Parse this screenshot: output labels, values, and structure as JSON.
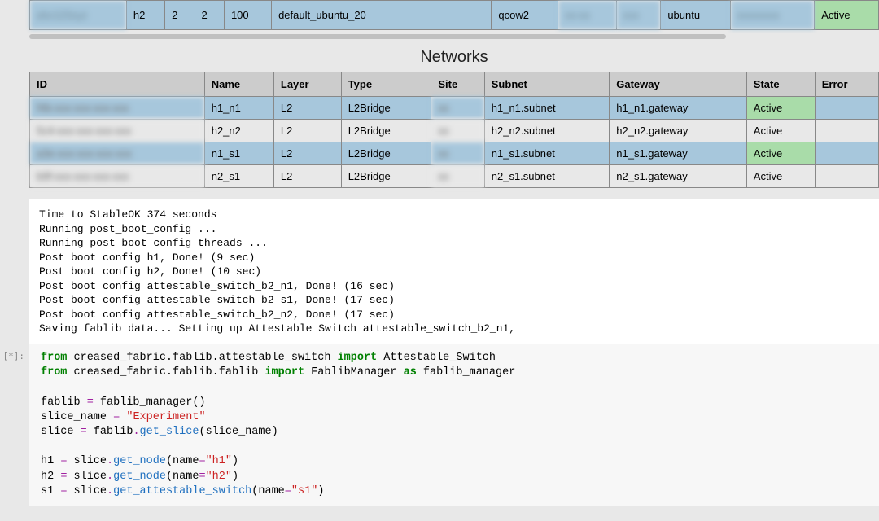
{
  "nodes_row": {
    "c0_blur": "abc123xyz",
    "name": "h2",
    "cpu": "2",
    "ram": "2",
    "disk": "100",
    "image": "default_ubuntu_20",
    "format": "qcow2",
    "c7_blur": "xx-xx",
    "c8_blur": "xxx",
    "user": "ubuntu",
    "c10_blur": "xxxxxxxx",
    "state": "Active"
  },
  "networks_title": "Networks",
  "net_headers": [
    "ID",
    "Name",
    "Layer",
    "Type",
    "Site",
    "Subnet",
    "Gateway",
    "State",
    "Error"
  ],
  "net_rows": [
    {
      "id_blur": "f4b-xxx-xxx-xxx-xxx",
      "name": "h1_n1",
      "layer": "L2",
      "type": "L2Bridge",
      "site_blur": "xx",
      "subnet": "h1_n1.subnet",
      "gateway": "h1_n1.gateway",
      "state": "Active",
      "error": "",
      "alt": false
    },
    {
      "id_blur": "5c4-xxx-xxx-xxx-xxx",
      "name": "h2_n2",
      "layer": "L2",
      "type": "L2Bridge",
      "site_blur": "xx",
      "subnet": "h2_n2.subnet",
      "gateway": "h2_n2.gateway",
      "state": "Active",
      "error": "",
      "alt": true
    },
    {
      "id_blur": "a3e-xxx-xxx-xxx-xxx",
      "name": "n1_s1",
      "layer": "L2",
      "type": "L2Bridge",
      "site_blur": "xx",
      "subnet": "n1_s1.subnet",
      "gateway": "n1_s1.gateway",
      "state": "Active",
      "error": "",
      "alt": false
    },
    {
      "id_blur": "b9f-xxx-xxx-xxx-xxx",
      "name": "n2_s1",
      "layer": "L2",
      "type": "L2Bridge",
      "site_blur": "xx",
      "subnet": "n2_s1.subnet",
      "gateway": "n2_s1.gateway",
      "state": "Active",
      "error": "",
      "alt": true
    }
  ],
  "output_text": "Time to StableOK 374 seconds\nRunning post_boot_config ...\nRunning post boot config threads ...\nPost boot config h1, Done! (9 sec)\nPost boot config h2, Done! (10 sec)\nPost boot config attestable_switch_b2_n1, Done! (16 sec)\nPost boot config attestable_switch_b2_s1, Done! (17 sec)\nPost boot config attestable_switch_b2_n2, Done! (17 sec)\nSaving fablib data... Setting up Attestable Switch attestable_switch_b2_n1,",
  "prompt": "[*]:",
  "code": {
    "l1": {
      "from": "from",
      "mod": " creased_fabric.fablib.attestable_switch ",
      "imp": "import",
      "tail": " Attestable_Switch"
    },
    "l2": {
      "from": "from",
      "mod": " creased_fabric.fablib.fablib ",
      "imp": "import",
      "mid": " FablibManager ",
      "as": "as",
      "tail": " fablib_manager"
    },
    "l4": {
      "a": "fablib ",
      "eq": "=",
      "b": " fablib_manager()"
    },
    "l5": {
      "a": "slice_name ",
      "eq": "=",
      "b": " ",
      "str": "\"Experiment\""
    },
    "l6": {
      "a": "slice ",
      "eq": "=",
      "b": " fablib",
      "dot": ".",
      "call": "get_slice",
      "args": "(slice_name)"
    },
    "l8": {
      "a": "h1 ",
      "eq": "=",
      "b": " slice",
      "dot": ".",
      "call": "get_node",
      "args_pre": "(name",
      "eq2": "=",
      "str": "\"h1\"",
      "args_post": ")"
    },
    "l9": {
      "a": "h2 ",
      "eq": "=",
      "b": " slice",
      "dot": ".",
      "call": "get_node",
      "args_pre": "(name",
      "eq2": "=",
      "str": "\"h2\"",
      "args_post": ")"
    },
    "l10": {
      "a": "s1 ",
      "eq": "=",
      "b": " slice",
      "dot": ".",
      "call": "get_attestable_switch",
      "args_pre": "(name",
      "eq2": "=",
      "str": "\"s1\"",
      "args_post": ")"
    }
  }
}
